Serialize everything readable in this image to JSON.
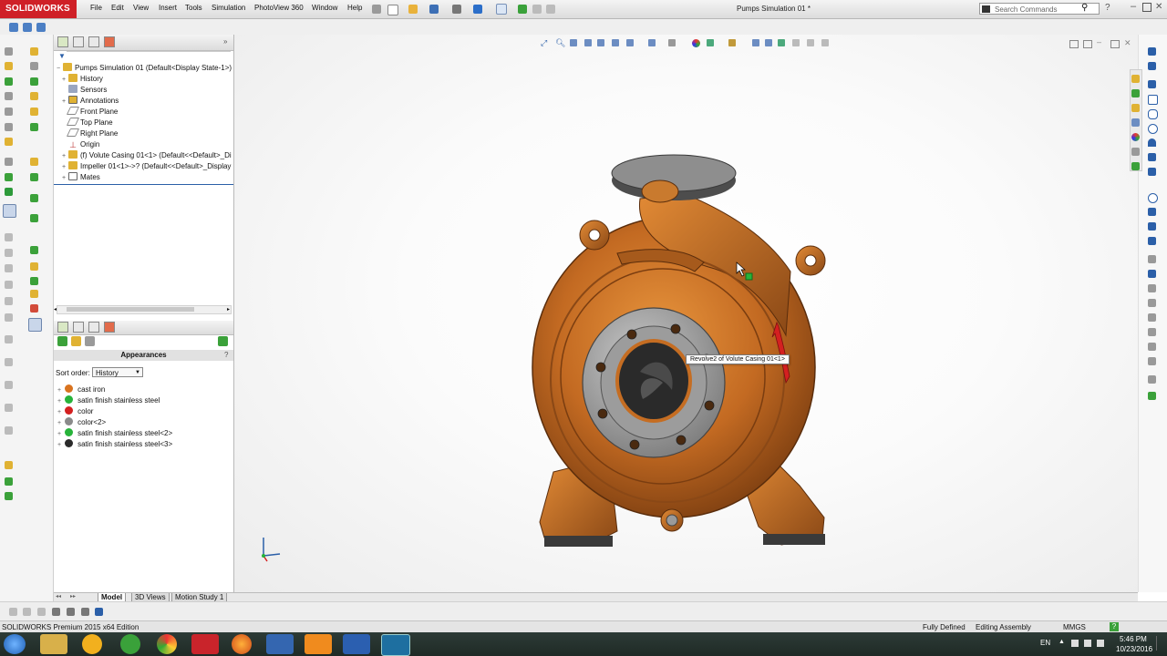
{
  "app": {
    "brand": "SOLIDWORKS",
    "document_title": "Pumps Simulation 01 *",
    "menus": [
      "File",
      "Edit",
      "View",
      "Insert",
      "Tools",
      "Simulation",
      "PhotoView 360",
      "Window",
      "Help"
    ],
    "search_placeholder": "Search Commands",
    "colors": {
      "brand_red": "#cf2027",
      "accent_blue": "#2b5fa8",
      "part_orange": "#c36a22"
    }
  },
  "feature_tree": {
    "root_label": "Pumps Simulation 01  (Default<Display State-1>)",
    "items": [
      {
        "label": "History",
        "icon": "history-folder-icon"
      },
      {
        "label": "Sensors",
        "icon": "sensors-folder-icon"
      },
      {
        "label": "Annotations",
        "icon": "annotations-icon"
      },
      {
        "label": "Front Plane",
        "icon": "plane-icon"
      },
      {
        "label": "Top Plane",
        "icon": "plane-icon"
      },
      {
        "label": "Right Plane",
        "icon": "plane-icon"
      },
      {
        "label": "Origin",
        "icon": "origin-icon"
      },
      {
        "label": "(f) Volute Casing 01<1> (Default<<Default>_Di",
        "icon": "part-icon"
      },
      {
        "label": "Impeller 01<1>->? (Default<<Default>_Display",
        "icon": "part-icon"
      },
      {
        "label": "Mates",
        "icon": "mates-icon"
      }
    ]
  },
  "appearances": {
    "header": "Appearances",
    "sort_label": "Sort order:",
    "sort_value": "History",
    "items": [
      {
        "label": "cast iron",
        "color": "#d9731f"
      },
      {
        "label": "satin finish stainless steel",
        "color": "#27b33a"
      },
      {
        "label": "color",
        "color": "#d42020"
      },
      {
        "label": "color<2>",
        "color": "#8a8a8a"
      },
      {
        "label": "satin finish stainless steel<2>",
        "color": "#27b33a"
      },
      {
        "label": "satin finish stainless steel<3>",
        "color": "#2a2a2a"
      }
    ]
  },
  "viewport": {
    "tooltip": "Revolve2 of Volute Casing 01<1>"
  },
  "bottom_tabs": [
    "Model",
    "3D Views",
    "Motion Study 1"
  ],
  "status": {
    "edition": "SOLIDWORKS Premium 2015 x64 Edition",
    "state": "Fully Defined",
    "mode": "Editing Assembly",
    "units": "MMGS",
    "help": "?"
  },
  "taskbar": {
    "language": "EN",
    "time": "5:46 PM",
    "date": "10/23/2016"
  }
}
